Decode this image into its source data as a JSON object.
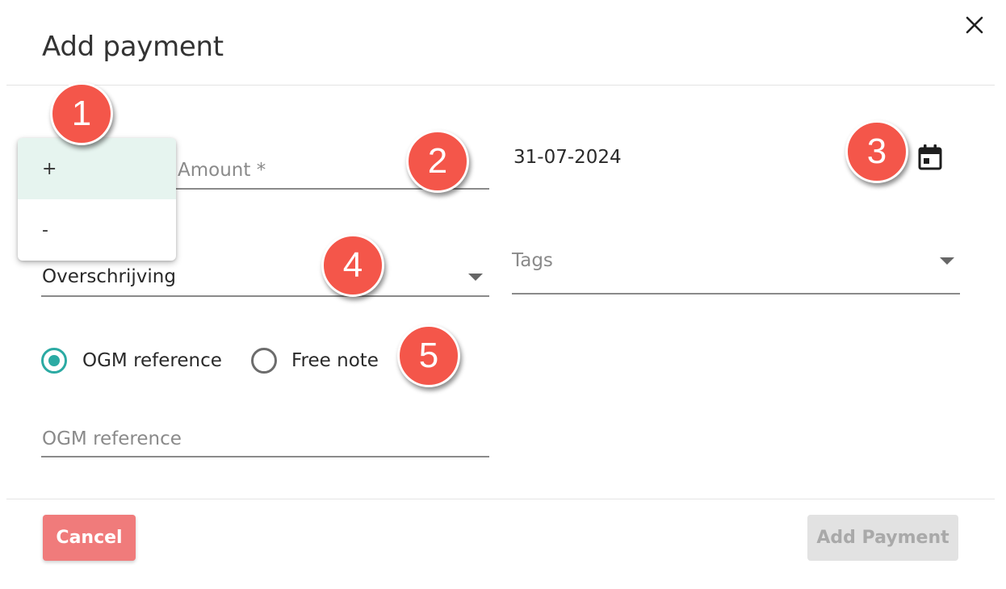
{
  "dialog": {
    "title": "Add payment",
    "close_icon": "close-icon"
  },
  "sign_menu": {
    "items": [
      {
        "label": "+",
        "selected": true
      },
      {
        "label": "-",
        "selected": false
      }
    ]
  },
  "amount": {
    "placeholder": "Amount *"
  },
  "date": {
    "value": "31-07-2024",
    "icon": "calendar-icon"
  },
  "payment_method": {
    "value": "Overschrijving"
  },
  "tags": {
    "placeholder": "Tags"
  },
  "reference_type": {
    "options": [
      {
        "label": "OGM reference",
        "selected": true
      },
      {
        "label": "Free note",
        "selected": false
      }
    ]
  },
  "ogm_field": {
    "placeholder": "OGM reference"
  },
  "buttons": {
    "cancel": "Cancel",
    "add": "Add Payment"
  },
  "markers": [
    "1",
    "2",
    "3",
    "4",
    "5"
  ],
  "colors": {
    "accent": "#2baaa3",
    "cancel_button": "#f07b7b",
    "disabled_button": "#e2e2e2",
    "marker": "#f4564a",
    "menu_selected": "#e6f4ef"
  }
}
